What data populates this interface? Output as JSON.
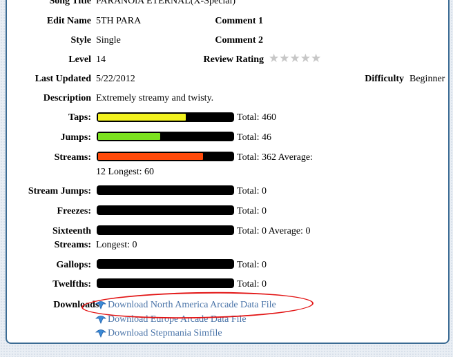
{
  "rows": {
    "song_title": {
      "label": "Song Title",
      "value": "PARANOiA ETERNAL(X-Special)"
    },
    "edit_name": {
      "label": "Edit Name",
      "value": "5TH PARA"
    },
    "comment1": {
      "label": "Comment 1",
      "value": ""
    },
    "style": {
      "label": "Style",
      "value": "Single"
    },
    "comment2": {
      "label": "Comment 2",
      "value": ""
    },
    "level": {
      "label": "Level",
      "value": "14"
    },
    "review_rating": {
      "label": "Review Rating",
      "stars": "★★★★★",
      "rating": 0
    },
    "last_updated": {
      "label": "Last Updated",
      "value": "5/22/2012"
    },
    "difficulty": {
      "label": "Difficulty",
      "value": "Beginner"
    },
    "description": {
      "label": "Description",
      "value": "Extremely streamy and twisty."
    }
  },
  "stats": {
    "taps": {
      "label": "Taps:",
      "text": "Total: 460",
      "fill": 0.65,
      "color": "#f2f21e"
    },
    "jumps": {
      "label": "Jumps:",
      "text": "Total: 46",
      "fill": 0.46,
      "color": "#7be11e"
    },
    "streams": {
      "label": "Streams:",
      "text": "Total: 362 Average:",
      "text2": "12 Longest: 60",
      "fill": 0.78,
      "color": "#ff4a0a"
    },
    "stream_jumps": {
      "label": "Stream Jumps:",
      "text": "Total: 0",
      "fill": 0
    },
    "freezes": {
      "label": "Freezes:",
      "text": "Total: 0",
      "fill": 0
    },
    "sixteenth": {
      "label": "Sixteenth",
      "label2": "Streams:",
      "text": "Total: 0 Average: 0",
      "text2": "Longest: 0",
      "fill": 0
    },
    "gallops": {
      "label": "Gallops:",
      "text": "Total: 0",
      "fill": 0
    },
    "twelfths": {
      "label": "Twelfths:",
      "text": "Total: 0",
      "fill": 0
    }
  },
  "downloads": {
    "label": "Downloads:",
    "icon": "download-arrow-icon",
    "items": [
      "Download North America Arcade Data File",
      "Download Europe Arcade Data File",
      "Download Stepmania Simfile"
    ],
    "highlight_color": "#e21414"
  }
}
